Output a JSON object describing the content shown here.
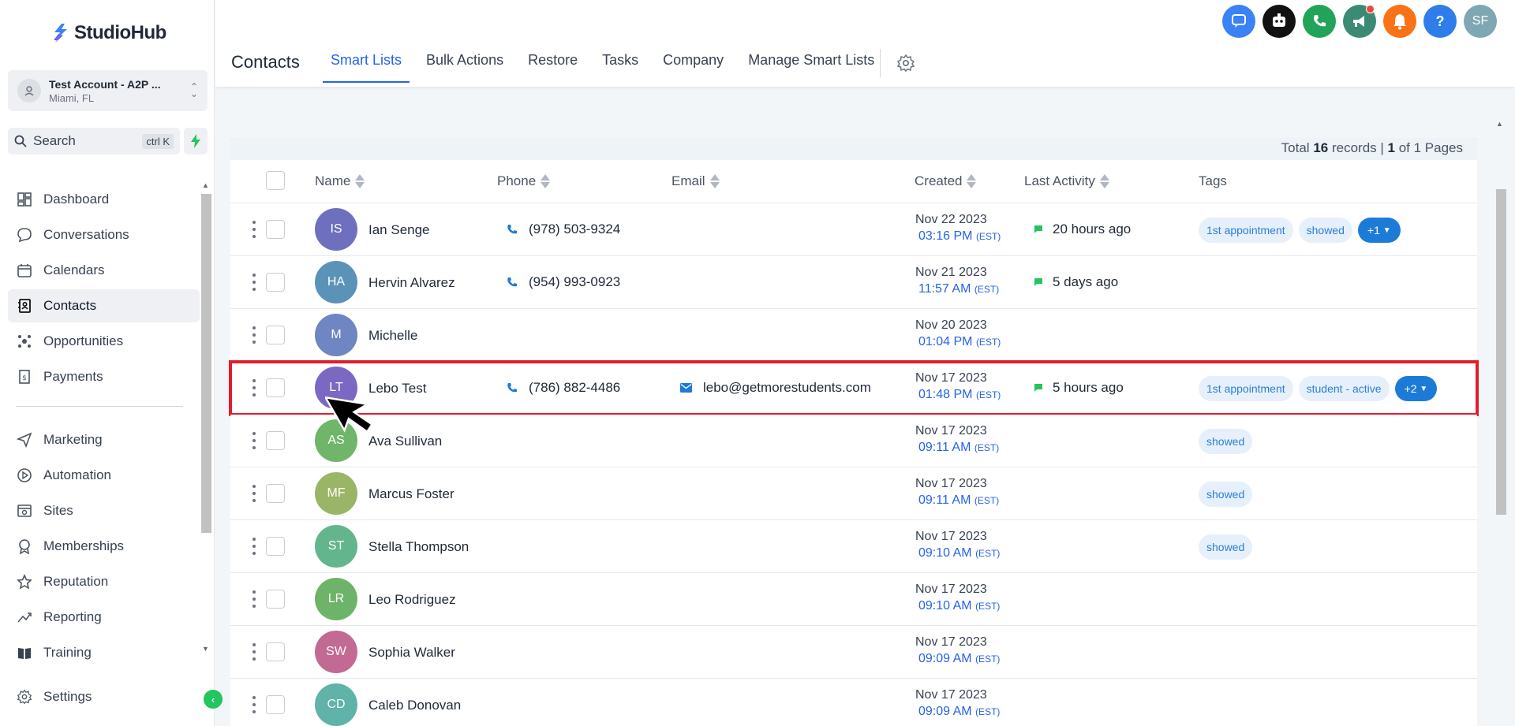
{
  "brand": {
    "name": "StudioHub",
    "accent": "#3b82f6"
  },
  "account": {
    "name": "Test Account - A2P ...",
    "location": "Miami, FL"
  },
  "search": {
    "label": "Search",
    "shortcut": "ctrl K"
  },
  "nav": {
    "items": [
      {
        "label": "Dashboard",
        "icon": "dashboard-icon"
      },
      {
        "label": "Conversations",
        "icon": "chat-icon"
      },
      {
        "label": "Calendars",
        "icon": "calendar-icon"
      },
      {
        "label": "Contacts",
        "icon": "contacts-icon",
        "active": true
      },
      {
        "label": "Opportunities",
        "icon": "opportunities-icon"
      },
      {
        "label": "Payments",
        "icon": "payments-icon"
      },
      {
        "label": "Marketing",
        "icon": "send-icon"
      },
      {
        "label": "Automation",
        "icon": "automation-icon"
      },
      {
        "label": "Sites",
        "icon": "sites-icon"
      },
      {
        "label": "Memberships",
        "icon": "badge-icon"
      },
      {
        "label": "Reputation",
        "icon": "star-icon"
      },
      {
        "label": "Reporting",
        "icon": "trend-icon"
      },
      {
        "label": "Training",
        "icon": "book-icon"
      }
    ],
    "settings": "Settings"
  },
  "header": {
    "title": "Contacts",
    "tabs": [
      "Smart Lists",
      "Bulk Actions",
      "Restore",
      "Tasks",
      "Company",
      "Manage Smart Lists"
    ],
    "active_tab": "Smart Lists",
    "user_initials": "SF"
  },
  "records": {
    "prefix": "Total ",
    "total": "16",
    "mid": " records | ",
    "page": "1",
    "suffix": " of 1 Pages"
  },
  "columns": {
    "name": "Name",
    "phone": "Phone",
    "email": "Email",
    "created": "Created",
    "last_activity": "Last Activity",
    "tags": "Tags"
  },
  "contacts": [
    {
      "initials": "IS",
      "name": "Ian Senge",
      "phone": "(978) 503-9324",
      "email": "",
      "date": "Nov 22 2023",
      "time": "03:16 PM",
      "tz": "(EST)",
      "activity": "20 hours ago",
      "tags": [
        "1st appointment",
        "showed"
      ],
      "more": "+1",
      "color": "#6f6fbf"
    },
    {
      "initials": "HA",
      "name": "Hervin Alvarez",
      "phone": "(954) 993-0923",
      "email": "",
      "date": "Nov 21 2023",
      "time": "11:57 AM",
      "tz": "(EST)",
      "activity": "5 days ago",
      "tags": [],
      "more": "",
      "color": "#5b93b8"
    },
    {
      "initials": "M",
      "name": "Michelle",
      "phone": "",
      "email": "",
      "date": "Nov 20 2023",
      "time": "01:04 PM",
      "tz": "(EST)",
      "activity": "",
      "tags": [],
      "more": "",
      "color": "#6f86c3"
    },
    {
      "initials": "LT",
      "name": "Lebo Test",
      "phone": "(786) 882-4486",
      "email": "lebo@getmorestudents.com",
      "date": "Nov 17 2023",
      "time": "01:48 PM",
      "tz": "(EST)",
      "activity": "5 hours ago",
      "tags": [
        "1st appointment",
        "student - active"
      ],
      "more": "+2",
      "color": "#7a68c2",
      "highlight": true
    },
    {
      "initials": "AS",
      "name": "Ava Sullivan",
      "phone": "",
      "email": "",
      "date": "Nov 17 2023",
      "time": "09:11 AM",
      "tz": "(EST)",
      "activity": "",
      "tags": [
        "showed"
      ],
      "more": "",
      "color": "#6fb56a"
    },
    {
      "initials": "MF",
      "name": "Marcus Foster",
      "phone": "",
      "email": "",
      "date": "Nov 17 2023",
      "time": "09:11 AM",
      "tz": "(EST)",
      "activity": "",
      "tags": [
        "showed"
      ],
      "more": "",
      "color": "#9bb566"
    },
    {
      "initials": "ST",
      "name": "Stella Thompson",
      "phone": "",
      "email": "",
      "date": "Nov 17 2023",
      "time": "09:10 AM",
      "tz": "(EST)",
      "activity": "",
      "tags": [
        "showed"
      ],
      "more": "",
      "color": "#62b58d"
    },
    {
      "initials": "LR",
      "name": "Leo Rodriguez",
      "phone": "",
      "email": "",
      "date": "Nov 17 2023",
      "time": "09:10 AM",
      "tz": "(EST)",
      "activity": "",
      "tags": [],
      "more": "",
      "color": "#6db46a"
    },
    {
      "initials": "SW",
      "name": "Sophia Walker",
      "phone": "",
      "email": "",
      "date": "Nov 17 2023",
      "time": "09:09 AM",
      "tz": "(EST)",
      "activity": "",
      "tags": [],
      "more": "",
      "color": "#c26a93"
    },
    {
      "initials": "CD",
      "name": "Caleb Donovan",
      "phone": "",
      "email": "",
      "date": "Nov 17 2023",
      "time": "09:09 AM",
      "tz": "(EST)",
      "activity": "",
      "tags": [],
      "more": "",
      "color": "#5fb3a8"
    }
  ]
}
